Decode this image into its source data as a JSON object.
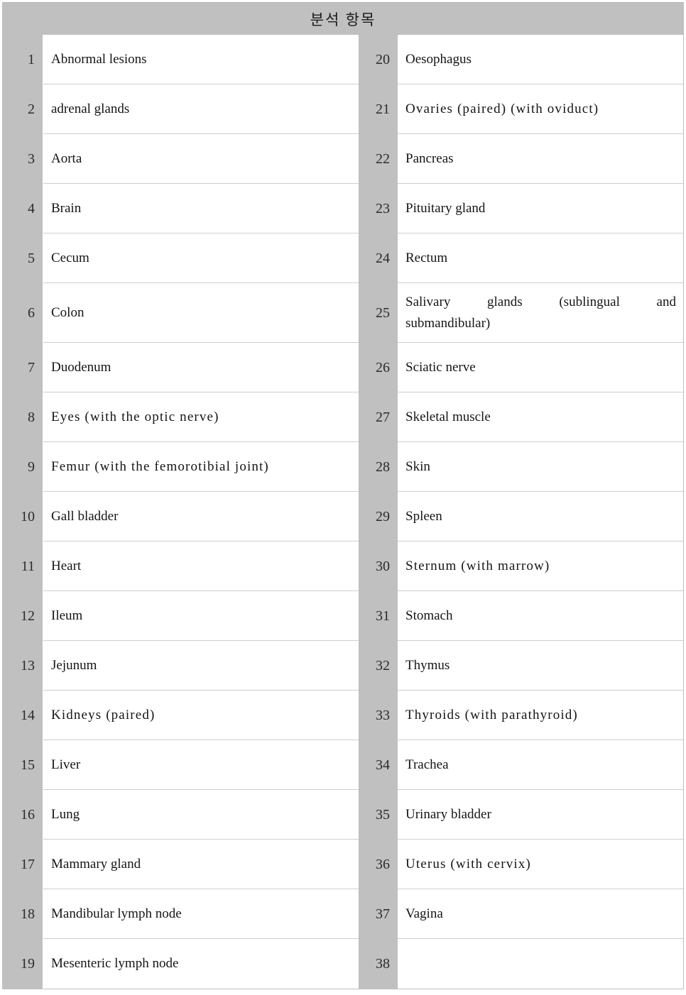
{
  "table": {
    "title": "분석 항목",
    "colors": {
      "header_background": "#c0c0c0",
      "number_cell_background": "#c0c0c0",
      "label_cell_background": "#ffffff",
      "row_separator": "#cfcfcf",
      "outer_border": "#bdbdbd",
      "text": "#151515"
    },
    "left_column": [
      {
        "no": "1",
        "label": "Abnormal lesions"
      },
      {
        "no": "2",
        "label": "adrenal glands"
      },
      {
        "no": "3",
        "label": "Aorta"
      },
      {
        "no": "4",
        "label": "Brain"
      },
      {
        "no": "5",
        "label": "Cecum"
      },
      {
        "no": "6",
        "label": "Colon"
      },
      {
        "no": "7",
        "label": "Duodenum"
      },
      {
        "no": "8",
        "label": "Eyes (with the optic nerve)"
      },
      {
        "no": "9",
        "label": "Femur (with the femorotibial joint)"
      },
      {
        "no": "10",
        "label": "Gall bladder"
      },
      {
        "no": "11",
        "label": "Heart"
      },
      {
        "no": "12",
        "label": "Ileum"
      },
      {
        "no": "13",
        "label": "Jejunum"
      },
      {
        "no": "14",
        "label": "Kidneys (paired)"
      },
      {
        "no": "15",
        "label": "Liver"
      },
      {
        "no": "16",
        "label": "Lung"
      },
      {
        "no": "17",
        "label": "Mammary gland"
      },
      {
        "no": "18",
        "label": "Mandibular lymph node"
      },
      {
        "no": "19",
        "label": "Mesenteric lymph node"
      }
    ],
    "right_column": [
      {
        "no": "20",
        "label": "Oesophagus"
      },
      {
        "no": "21",
        "label": "Ovaries (paired) (with oviduct)"
      },
      {
        "no": "22",
        "label": "Pancreas"
      },
      {
        "no": "23",
        "label": "Pituitary gland"
      },
      {
        "no": "24",
        "label": "Rectum"
      },
      {
        "no": "25",
        "label": "Salivary glands (sublingual and submandibular)",
        "line1": "Salivary glands (sublingual and",
        "line2": "submandibular)"
      },
      {
        "no": "26",
        "label": "Sciatic nerve"
      },
      {
        "no": "27",
        "label": "Skeletal muscle"
      },
      {
        "no": "28",
        "label": "Skin"
      },
      {
        "no": "29",
        "label": "Spleen"
      },
      {
        "no": "30",
        "label": "Sternum (with marrow)"
      },
      {
        "no": "31",
        "label": "Stomach"
      },
      {
        "no": "32",
        "label": "Thymus"
      },
      {
        "no": "33",
        "label": "Thyroids (with parathyroid)"
      },
      {
        "no": "34",
        "label": "Trachea"
      },
      {
        "no": "35",
        "label": "Urinary bladder"
      },
      {
        "no": "36",
        "label": "Uterus (with cervix)"
      },
      {
        "no": "37",
        "label": "Vagina"
      },
      {
        "no": "38",
        "label": ""
      }
    ]
  }
}
